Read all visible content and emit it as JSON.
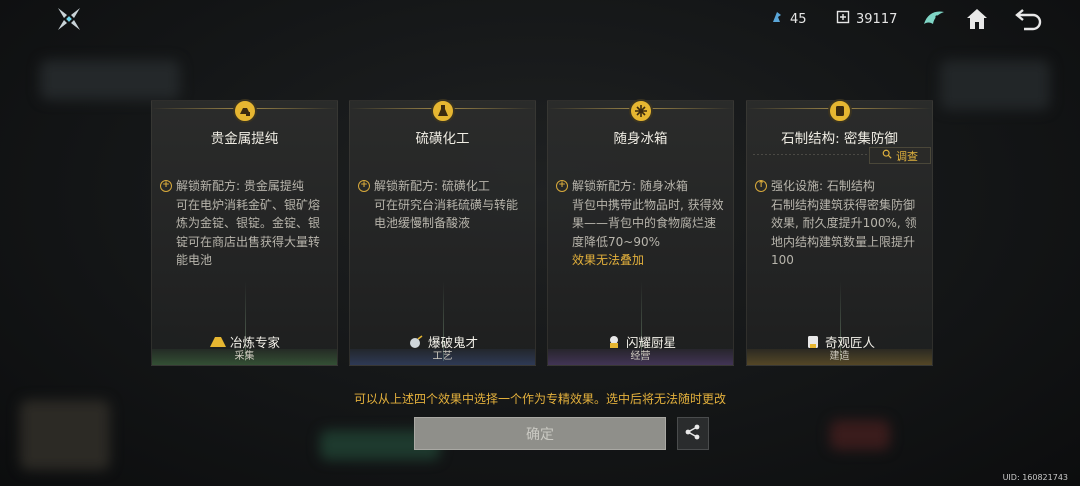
{
  "topbar": {
    "resource1_value": "45",
    "resource2_value": "39117"
  },
  "cards": [
    {
      "title": "贵金属提纯",
      "effect_head": "解锁新配方: 贵金属提纯",
      "effect_desc": "可在电炉消耗金矿、银矿熔炼为金锭、银锭。金锭、银锭可在商店出售获得大量转能电池",
      "warning": "",
      "specialty": "冶炼专家",
      "category": "采集",
      "inspect_label": ""
    },
    {
      "title": "硫磺化工",
      "effect_head": "解锁新配方: 硫磺化工",
      "effect_desc": "可在研究台消耗硫磺与转能电池缓慢制备酸液",
      "warning": "",
      "specialty": "爆破鬼才",
      "category": "工艺",
      "inspect_label": ""
    },
    {
      "title": "随身冰箱",
      "effect_head": "解锁新配方: 随身冰箱",
      "effect_desc": "背包中携带此物品时, 获得效果——背包中的食物腐烂速度降低70~90%",
      "warning": "效果无法叠加",
      "specialty": "闪耀厨星",
      "category": "经营",
      "inspect_label": ""
    },
    {
      "title": "石制结构: 密集防御",
      "effect_head": "强化设施: 石制结构",
      "effect_desc": "石制结构建筑获得密集防御效果, 耐久度提升100%, 领地内结构建筑数量上限提升100",
      "warning": "",
      "specialty": "奇观匠人",
      "category": "建造",
      "inspect_label": "调查"
    }
  ],
  "hint": "可以从上述四个效果中选择一个作为专精效果。选中后将无法随时更改",
  "confirm_label": "确定",
  "uid": "UID: 160821743",
  "colors": {
    "accent_gold": "#e3b03c",
    "badge_gold": "#e6b631"
  },
  "icons": {
    "logo": "game-logo-icon",
    "resource1": "energy-crystal-icon",
    "resource2": "currency-icon",
    "guild": "guild-emblem-icon",
    "home": "home-icon",
    "back": "back-icon",
    "share": "share-icon"
  }
}
